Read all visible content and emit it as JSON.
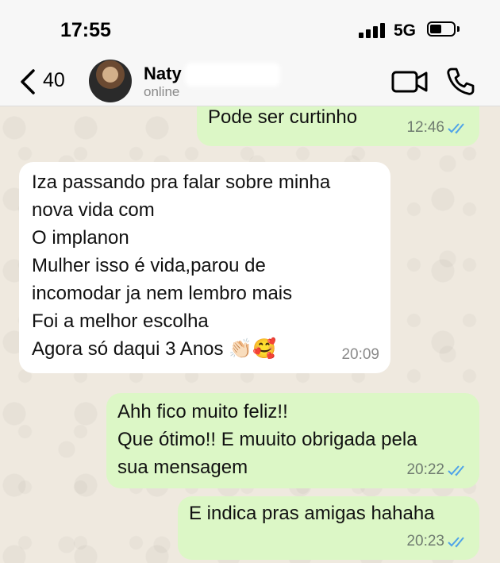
{
  "status_bar": {
    "time": "17:55",
    "network": "5G"
  },
  "header": {
    "back_count": "40",
    "contact_name": "Naty",
    "contact_status": "online"
  },
  "messages": [
    {
      "direction": "out",
      "text": "Pode ser curtinho",
      "time": "12:46",
      "read": true
    },
    {
      "direction": "in",
      "text": "Iza passando pra falar sobre minha\nnova vida com\nO implanon\nMulher isso é vida,parou de\nincomodar ja nem lembro mais\nFoi a melhor escolha\nAgora só daqui 3 Anos 👏🏻🥰",
      "time": "20:09"
    },
    {
      "direction": "out",
      "text": "Ahh fico muito feliz!!\nQue ótimo!! E muuito obrigada pela\nsua mensagem",
      "time": "20:22",
      "read": true
    },
    {
      "direction": "out",
      "text": "E indica pras amigas hahaha",
      "time": "20:23",
      "read": true
    }
  ],
  "colors": {
    "outgoing_bubble": "#dcf7c6",
    "incoming_bubble": "#ffffff",
    "read_tick": "#4fa3e8",
    "background": "#efe9df"
  },
  "icons": [
    "chevron-left-icon",
    "video-camera-icon",
    "phone-icon",
    "double-check-icon"
  ]
}
